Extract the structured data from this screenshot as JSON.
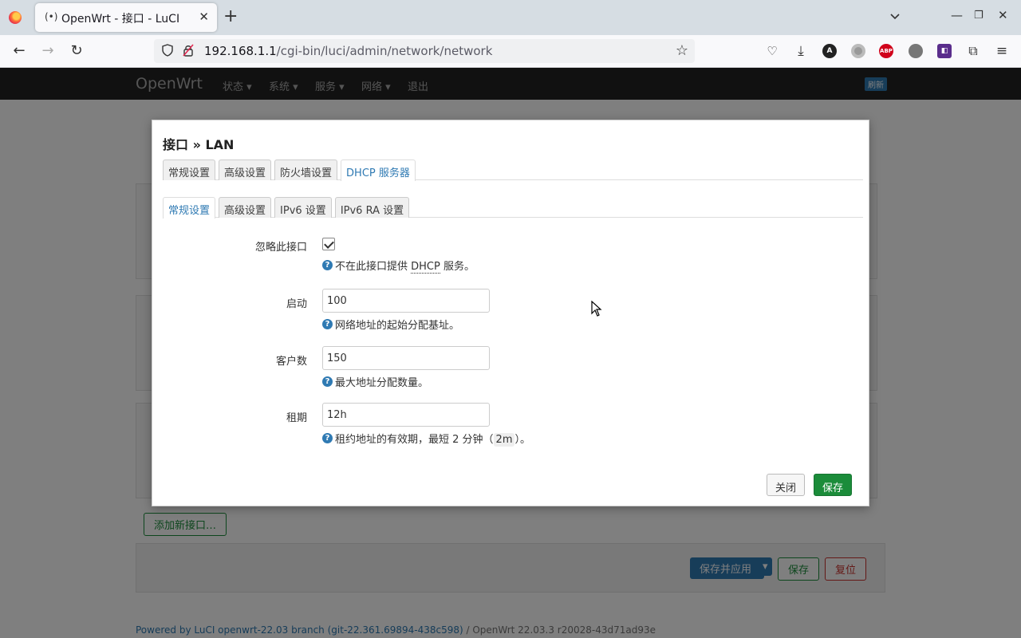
{
  "browser": {
    "tab_title": "OpenWrt - 接口 - LuCI",
    "tab_icon": "(•)",
    "url_host": "192.168.1.1",
    "url_path": "/cgi-bin/luci/admin/network/network"
  },
  "header": {
    "brand": "OpenWrt",
    "menu": [
      "状态 ▾",
      "系统 ▾",
      "服务 ▾",
      "网络 ▾",
      "退出"
    ],
    "refresh_badge": "刷新"
  },
  "background": {
    "add_interface_label": "添加新接口…",
    "save_apply_label": "保存并应用",
    "save_apply_dropdown": "▾",
    "save_label": "保存",
    "reset_label": "复位",
    "footer_link": "Powered by LuCI openwrt-22.03 branch (git-22.361.69894-438c598)",
    "footer_rest": " / OpenWrt 22.03.3 r20028-43d71ad93e"
  },
  "modal": {
    "title": "接口 » LAN",
    "tabs": [
      "常规设置",
      "高级设置",
      "防火墙设置",
      "DHCP 服务器"
    ],
    "active_tab": 3,
    "subtabs": [
      "常规设置",
      "高级设置",
      "IPv6 设置",
      "IPv6 RA 设置"
    ],
    "active_subtab": 0,
    "fields": {
      "ignore": {
        "label": "忽略此接口",
        "checked": true,
        "help_pre": "不在此接口提供 ",
        "help_abbr": "DHCP",
        "help_post": " 服务。"
      },
      "start": {
        "label": "启动",
        "value": "100",
        "help": "网络地址的起始分配基址。"
      },
      "limit": {
        "label": "客户数",
        "value": "150",
        "help": "最大地址分配数量。"
      },
      "leasetime": {
        "label": "租期",
        "value": "12h",
        "help_pre": "租约地址的有效期，最短 2 分钟（",
        "help_code": "2m",
        "help_post": "）。"
      }
    },
    "close_label": "关闭",
    "save_label": "保存"
  }
}
